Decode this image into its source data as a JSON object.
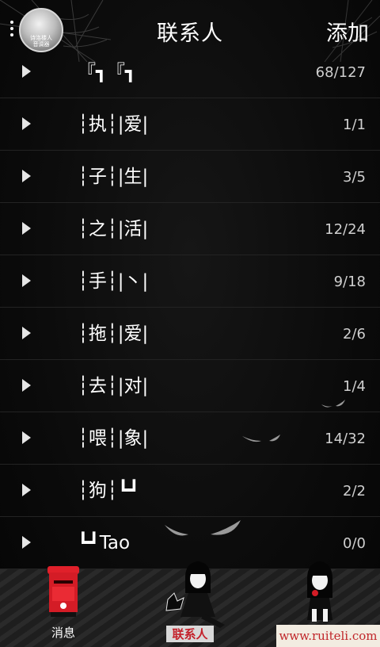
{
  "header": {
    "title": "联系人",
    "add_label": "添加",
    "avatar_caption_1": "诗洛楼人",
    "avatar_caption_2": "音调器"
  },
  "groups": [
    {
      "name": "『┓『┓",
      "count": "68/127"
    },
    {
      "name": "┆执┆|爱|",
      "count": "1/1"
    },
    {
      "name": "┆子┆|生|",
      "count": "3/5"
    },
    {
      "name": "┆之┆|活|",
      "count": "12/24"
    },
    {
      "name": "┆手┆|丶|",
      "count": "9/18"
    },
    {
      "name": "┆拖┆|爱|",
      "count": "2/6"
    },
    {
      "name": "┆去┆|对|",
      "count": "1/4"
    },
    {
      "name": "┆喂┆|象|",
      "count": "14/32"
    },
    {
      "name": "┆狗┆┗┛",
      "count": "2/2"
    },
    {
      "name": "┗┛Tao",
      "count": "0/0"
    }
  ],
  "tabbar": {
    "messages_label": "消息",
    "contacts_label": "联系人"
  },
  "watermark": "www.ruiteli.com",
  "colors": {
    "background": "#0a0a0a",
    "accent_red": "#c4202a",
    "text": "#ffffff"
  }
}
